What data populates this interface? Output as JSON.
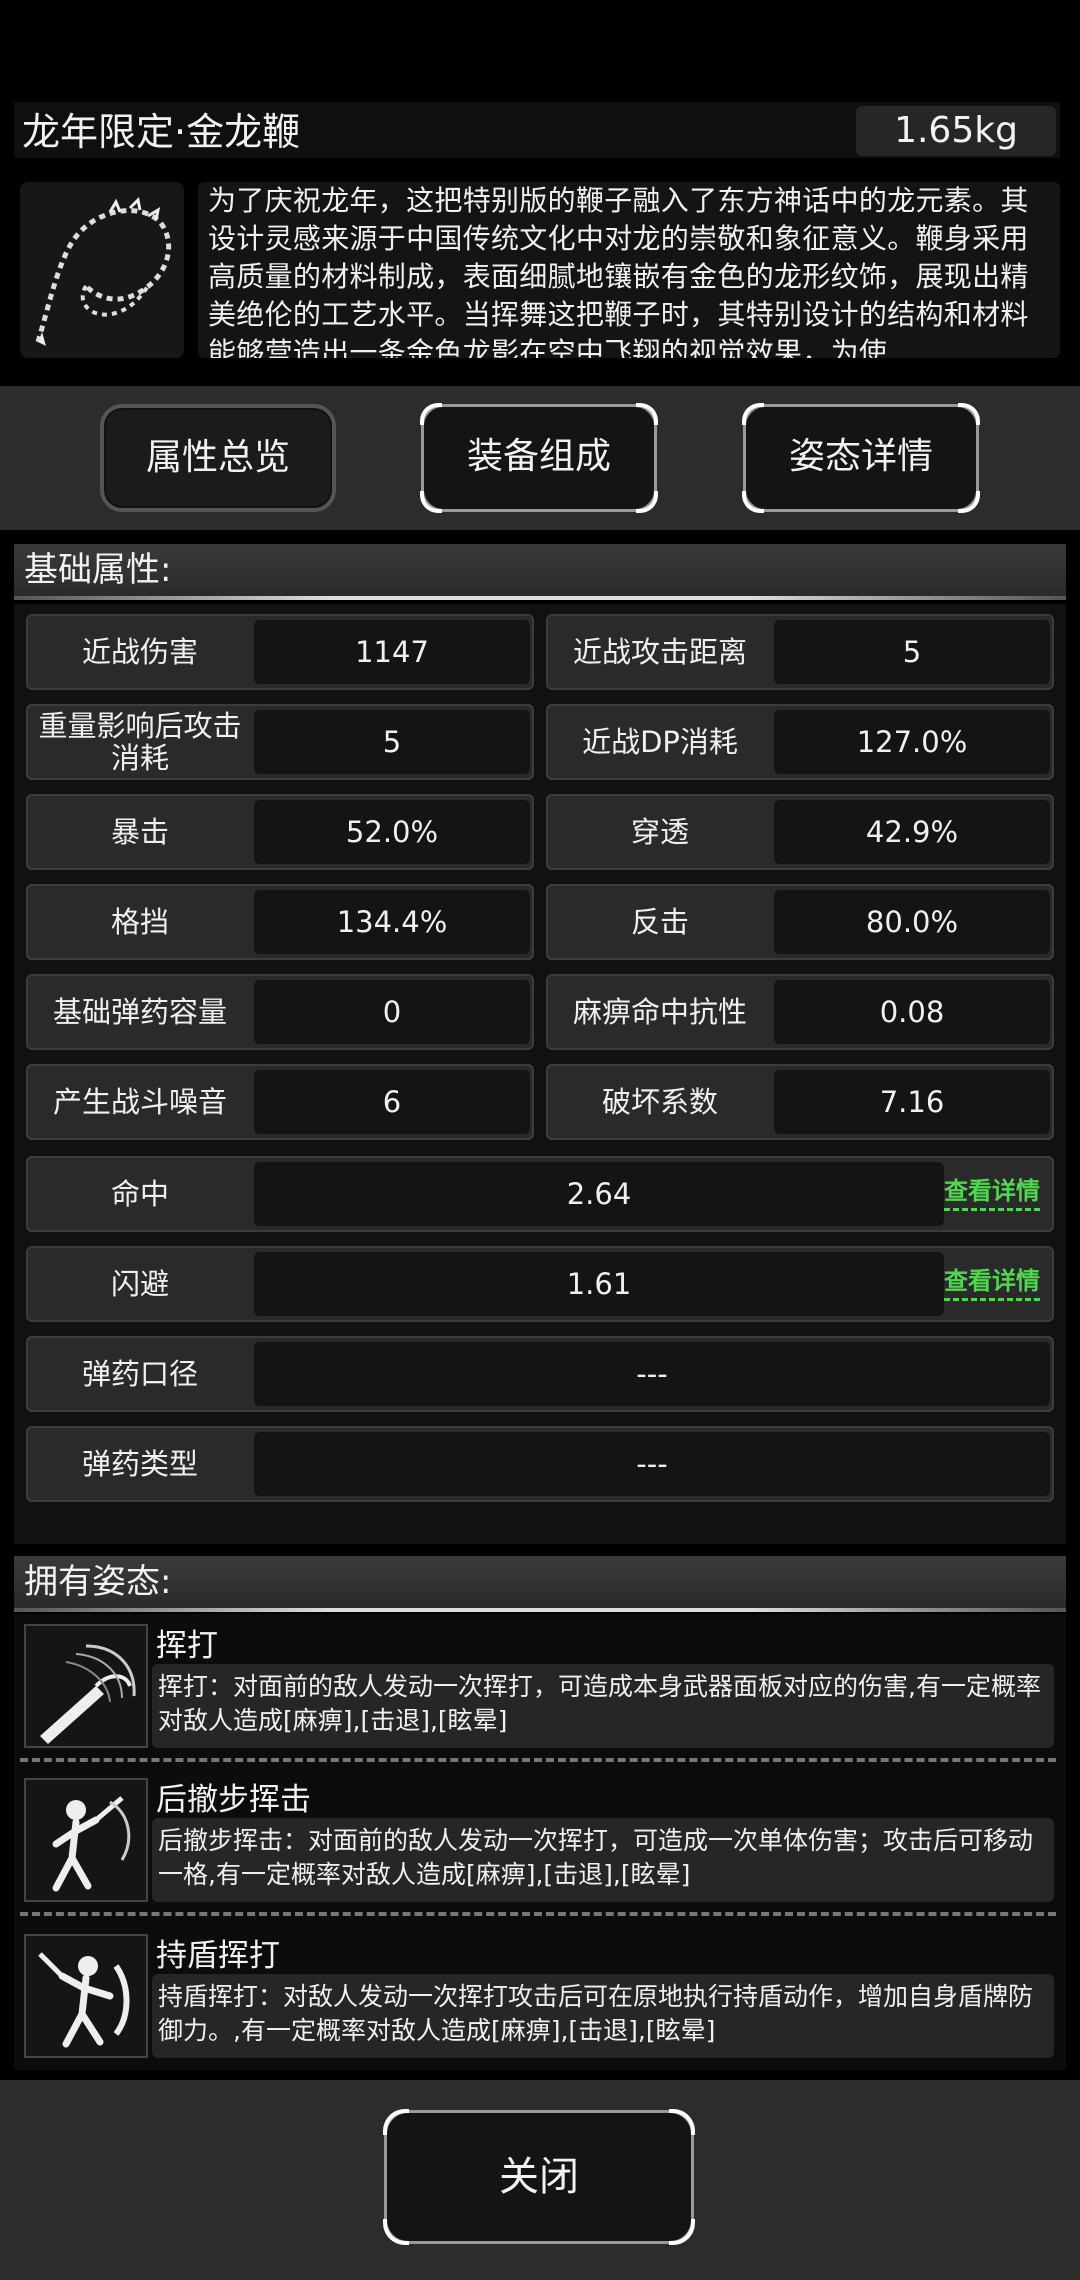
{
  "item": {
    "title": "龙年限定·金龙鞭",
    "weight": "1.65kg",
    "description": "为了庆祝龙年，这把特别版的鞭子融入了东方神话中的龙元素。其设计灵感来源于中国传统文化中对龙的崇敬和象征意义。鞭身采用高质量的材料制成，表面细腻地镶嵌有金色的龙形纹饰，展现出精美绝伦的工艺水平。当挥舞这把鞭子时，其特别设计的结构和材料能够营造出一条金色龙影在空中飞翔的视觉效果，为使"
  },
  "tabs": [
    {
      "label": "属性总览"
    },
    {
      "label": "装备组成"
    },
    {
      "label": "姿态详情"
    }
  ],
  "attributes": {
    "header": "基础属性:",
    "pairs": [
      {
        "l_label": "近战伤害",
        "l_value": "1147",
        "r_label": "近战攻击距离",
        "r_value": "5"
      },
      {
        "l_label": "重量影响后攻击消耗",
        "l_value": "5",
        "r_label": "近战DP消耗",
        "r_value": "127.0%"
      },
      {
        "l_label": "暴击",
        "l_value": "52.0%",
        "r_label": "穿透",
        "r_value": "42.9%"
      },
      {
        "l_label": "格挡",
        "l_value": "134.4%",
        "r_label": "反击",
        "r_value": "80.0%"
      },
      {
        "l_label": "基础弹药容量",
        "l_value": "0",
        "r_label": "麻痹命中抗性",
        "r_value": "0.08"
      },
      {
        "l_label": "产生战斗噪音",
        "l_value": "6",
        "r_label": "破坏系数",
        "r_value": "7.16"
      }
    ],
    "wide": [
      {
        "label": "命中",
        "value": "2.64",
        "link": "查看详情"
      },
      {
        "label": "闪避",
        "value": "1.61",
        "link": "查看详情"
      },
      {
        "label": "弹药口径",
        "value": "---"
      },
      {
        "label": "弹药类型",
        "value": "---"
      }
    ]
  },
  "stances": {
    "header": "拥有姿态:",
    "items": [
      {
        "name": "挥打",
        "desc": "挥打：对面前的敌人发动一次挥打，可造成本身武器面板对应的伤害,有一定概率对敌人造成[麻痹],[击退],[眩晕]"
      },
      {
        "name": "后撤步挥击",
        "desc": "后撤步挥击：对面前的敌人发动一次挥打，可造成一次单体伤害；攻击后可移动一格,有一定概率对敌人造成[麻痹],[击退],[眩晕]"
      },
      {
        "name": "持盾挥打",
        "desc": "持盾挥打：对敌人发动一次挥打攻击后可在原地执行持盾动作，增加自身盾牌防御力。,有一定概率对敌人造成[麻痹],[击退],[眩晕]"
      }
    ]
  },
  "footer": {
    "close_label": "关闭"
  },
  "colors": {
    "link_green": "#4fd84f",
    "panel_dark": "#111111",
    "cell_bg": "#2a2a2a"
  }
}
